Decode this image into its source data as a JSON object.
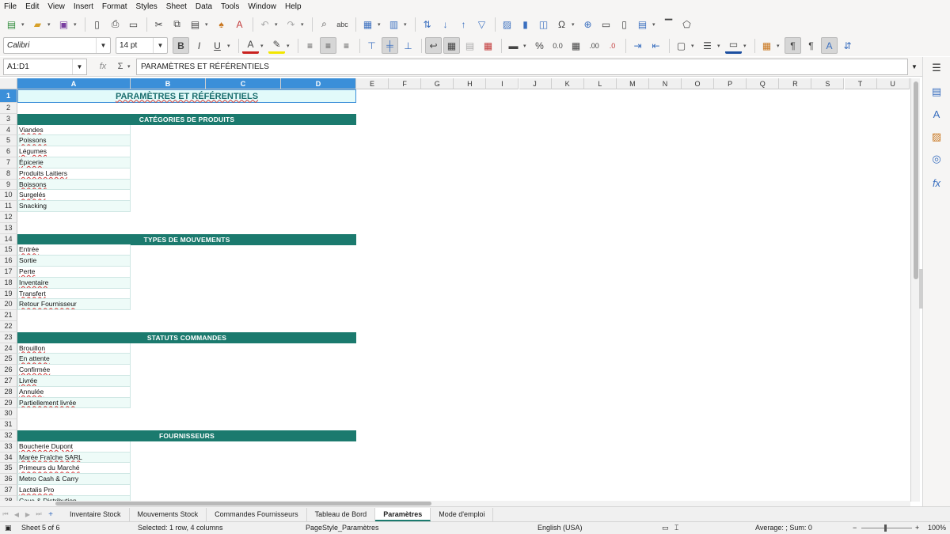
{
  "menu": [
    "File",
    "Edit",
    "View",
    "Insert",
    "Format",
    "Styles",
    "Sheet",
    "Data",
    "Tools",
    "Window",
    "Help"
  ],
  "format_bar": {
    "font_name": "Calibri",
    "font_size": "14 pt"
  },
  "formula_bar": {
    "name_box": "A1:D1",
    "fx_symbol": "fx",
    "sigma_symbol": "Σ",
    "equals_symbol": "=",
    "content": "PARAMÈTRES ET RÉFÉRENTIELS"
  },
  "columns": [
    "A",
    "B",
    "C",
    "D",
    "E",
    "F",
    "G",
    "H",
    "I",
    "J",
    "K",
    "L",
    "M",
    "N",
    "O",
    "P",
    "Q",
    "R",
    "S",
    "T",
    "U"
  ],
  "selected_columns": [
    "A",
    "B",
    "C",
    "D"
  ],
  "rows": [
    "1",
    "2",
    "3",
    "4",
    "5",
    "6",
    "7",
    "8",
    "9",
    "10",
    "11",
    "12",
    "13",
    "14",
    "15",
    "16",
    "17",
    "18",
    "19",
    "20",
    "21",
    "22",
    "23",
    "24",
    "25",
    "26",
    "27",
    "28",
    "29",
    "30",
    "31",
    "32",
    "33",
    "34",
    "35",
    "36",
    "37",
    "38"
  ],
  "sheet": {
    "title": "PARAMÈTRES ET RÉFÉRENTIELS",
    "sections": [
      {
        "header": "CATÉGORIES DE PRODUITS",
        "items": [
          "Viandes",
          "Poissons",
          "Légumes",
          "Épicerie",
          "Produits Laitiers",
          "Boissons",
          "Surgelés",
          "Snacking"
        ]
      },
      {
        "header": "TYPES DE MOUVEMENTS",
        "items": [
          "Entrée",
          "Sortie",
          "Perte",
          "Inventaire",
          "Transfert",
          "Retour Fournisseur"
        ]
      },
      {
        "header": "STATUTS COMMANDES",
        "items": [
          "Brouillon",
          "En attente",
          "Confirmée",
          "Livrée",
          "Annulée",
          "Partiellement livrée"
        ]
      },
      {
        "header": "FOURNISSEURS",
        "items": [
          "Boucherie Dupont",
          "Marée Fraîche SARL",
          "Primeurs du Marché",
          "Metro Cash & Carry",
          "Lactalis Pro",
          "Cave & Distribution"
        ]
      }
    ]
  },
  "sheet_tabs": [
    "Inventaire Stock",
    "Mouvements Stock",
    "Commandes Fournisseurs",
    "Tableau de Bord",
    "Paramètres",
    "Mode d'emploi"
  ],
  "active_tab": "Paramètres",
  "status_bar": {
    "sheet_position": "Sheet 5 of 6",
    "selection": "Selected: 1 row, 4 columns",
    "page_style": "PageStyle_Paramètres",
    "language": "English (USA)",
    "summary": "Average: ; Sum: 0",
    "zoom": "100%"
  },
  "colors": {
    "section_header_bg": "#1b7a6e",
    "title_bg": "#e2fafa",
    "selection": "#3b8fd9"
  }
}
